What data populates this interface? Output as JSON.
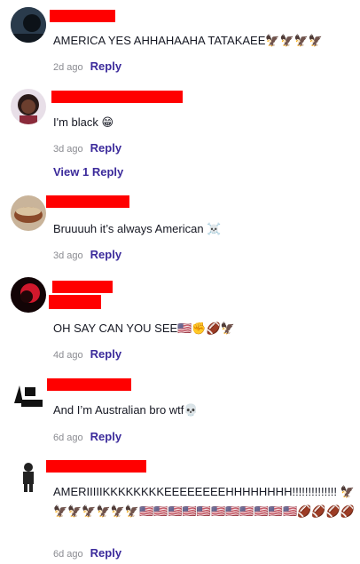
{
  "comments": [
    {
      "text": "AMERICA YES AHHAHAAHA TATAKAEE🦅🦅🦅🦅",
      "time": "2d ago",
      "reply": "Reply"
    },
    {
      "text": "I'm black 😁",
      "time": "3d ago",
      "reply": "Reply",
      "view_replies": "View 1 Reply"
    },
    {
      "text": "Bruuuuh it’s always American ☠️",
      "time": "3d ago",
      "reply": "Reply"
    },
    {
      "text": "OH SAY CAN YOU SEE🇺🇸✊🏈🦅",
      "time": "4d ago",
      "reply": "Reply"
    },
    {
      "text": "And I’m Australian bro wtf💀",
      "time": "6d ago",
      "reply": "Reply"
    },
    {
      "text": "AMERIIIIIKKKKKKKKEEEEEEEEHHHHHHHH!!!!!!!!!!!!!! 🦅🦅🦅🦅🦅🦅🦅🇺🇸🇺🇸🇺🇸🇺🇸🇺🇸🇺🇸🇺🇸🇺🇸🇺🇸🇺🇸🇺🇸🏈🏈🏈🏈",
      "time": "6d ago",
      "reply": "Reply"
    }
  ]
}
